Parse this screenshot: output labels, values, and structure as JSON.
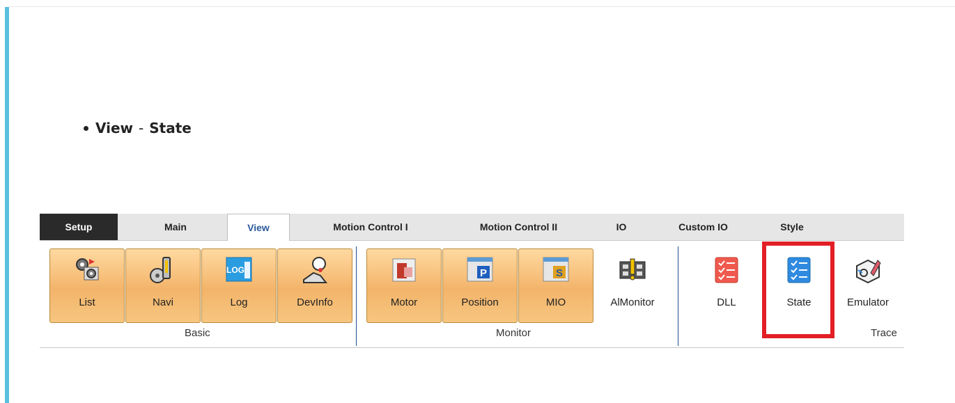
{
  "heading": {
    "first": "View",
    "separator": "-",
    "second": "State"
  },
  "tabs": [
    {
      "label": "Setup"
    },
    {
      "label": "Main"
    },
    {
      "label": "View"
    },
    {
      "label": "Motion Control I"
    },
    {
      "label": "Motion Control II"
    },
    {
      "label": "IO"
    },
    {
      "label": "Custom IO"
    },
    {
      "label": "Style"
    }
  ],
  "buttons": {
    "list": "List",
    "navi": "Navi",
    "log": "Log",
    "devinfo": "DevInfo",
    "motor": "Motor",
    "position": "Position",
    "mio": "MIO",
    "aimonitor": "AlMonitor",
    "dll": "DLL",
    "state": "State",
    "emulator": "Emulator"
  },
  "groups": {
    "basic": "Basic",
    "monitor": "Monitor",
    "trace": "Trace"
  },
  "icon_texts": {
    "log": "LOG",
    "position": "P",
    "mio": "S"
  },
  "colors": {
    "accent_bar": "#5bc0de",
    "highlight": "#e21f26",
    "button_fill": "#f3b46a",
    "state_icon": "#2f8ae0",
    "dll_icon": "#f05a4e"
  }
}
